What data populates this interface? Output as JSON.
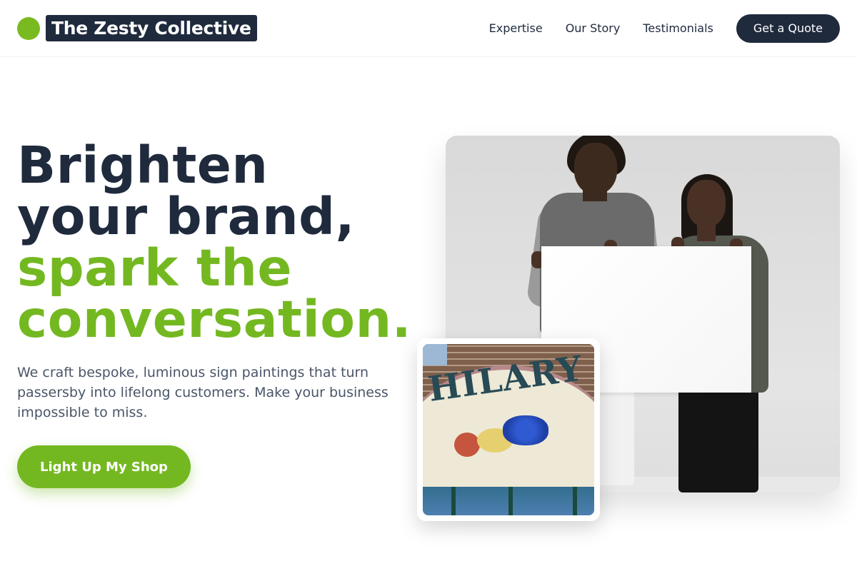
{
  "header": {
    "brand_name": "The Zesty Collective",
    "nav": [
      {
        "label": "Expertise"
      },
      {
        "label": "Our Story"
      },
      {
        "label": "Testimonials"
      }
    ],
    "cta_label": "Get a Quote"
  },
  "hero": {
    "title_lines": [
      "Brighten",
      "your brand,",
      "spark the",
      "conversation."
    ],
    "description": "We craft bespoke, luminous sign paintings that turn passersby into lifelong customers. Make your business impossible to miss.",
    "cta_label": "Light Up My Shop"
  },
  "images": {
    "inset_sign_text": "HILARY"
  },
  "colors": {
    "accent": "#74b821",
    "dark": "#1f2a3d",
    "text_muted": "#4a5568"
  },
  "icons": [
    "brand-logo-dot-icon"
  ]
}
